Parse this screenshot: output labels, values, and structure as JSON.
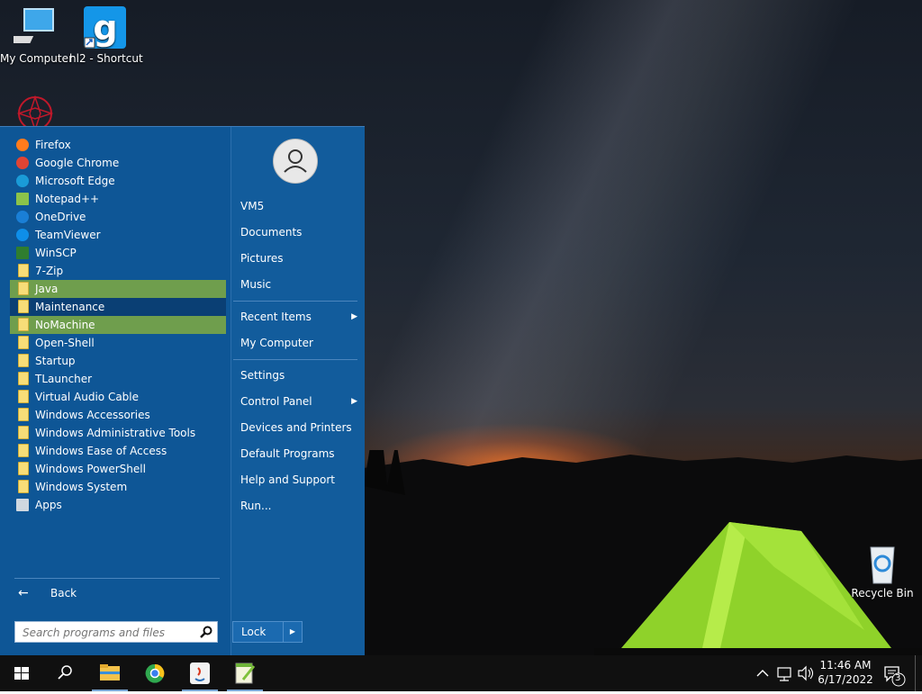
{
  "desktop": {
    "icons": [
      {
        "label": "My Computer",
        "icon": "computer-icon"
      },
      {
        "label": "hl2 - Shortcut",
        "icon": "garrys-mod-icon"
      },
      {
        "label": "Recycle Bin",
        "icon": "recycle-bin-icon"
      }
    ]
  },
  "start_menu": {
    "programs": [
      {
        "label": "Firefox",
        "icon": "firefox-icon"
      },
      {
        "label": "Google Chrome",
        "icon": "chrome-icon"
      },
      {
        "label": "Microsoft Edge",
        "icon": "edge-icon"
      },
      {
        "label": "Notepad++",
        "icon": "notepadpp-icon"
      },
      {
        "label": "OneDrive",
        "icon": "onedrive-icon"
      },
      {
        "label": "TeamViewer",
        "icon": "teamviewer-icon"
      },
      {
        "label": "WinSCP",
        "icon": "winscp-icon"
      },
      {
        "label": "7-Zip",
        "icon": "folder-icon"
      },
      {
        "label": "Java",
        "icon": "folder-icon"
      },
      {
        "label": "Maintenance",
        "icon": "folder-icon"
      },
      {
        "label": "NoMachine",
        "icon": "folder-icon"
      },
      {
        "label": "Open-Shell",
        "icon": "folder-icon"
      },
      {
        "label": "Startup",
        "icon": "folder-icon"
      },
      {
        "label": "TLauncher",
        "icon": "folder-icon"
      },
      {
        "label": "Virtual Audio Cable",
        "icon": "folder-icon"
      },
      {
        "label": "Windows Accessories",
        "icon": "folder-icon"
      },
      {
        "label": "Windows Administrative Tools",
        "icon": "folder-icon"
      },
      {
        "label": "Windows Ease of Access",
        "icon": "folder-icon"
      },
      {
        "label": "Windows PowerShell",
        "icon": "folder-icon"
      },
      {
        "label": "Windows System",
        "icon": "folder-icon"
      },
      {
        "label": "Apps",
        "icon": "apps-icon"
      }
    ],
    "back_label": "Back",
    "search_placeholder": "Search programs and files",
    "right_items": {
      "user": "VM5",
      "documents": "Documents",
      "pictures": "Pictures",
      "music": "Music",
      "recent_items": "Recent Items",
      "my_computer": "My Computer",
      "settings": "Settings",
      "control_panel": "Control Panel",
      "devices_printers": "Devices and Printers",
      "default_programs": "Default Programs",
      "help_support": "Help and Support",
      "run": "Run..."
    },
    "lock_label": "Lock"
  },
  "taskbar": {
    "apps": [
      "start-button",
      "search-icon",
      "file-explorer-icon",
      "chrome-icon",
      "java-icon",
      "notepadpp-icon"
    ],
    "time": "11:46 AM",
    "date": "6/17/2022",
    "notification_count": "3"
  },
  "colors": {
    "menu_bg": "#0e5696",
    "highlight_green": "#6f9e4d",
    "highlight_selected": "#0a3f74"
  }
}
